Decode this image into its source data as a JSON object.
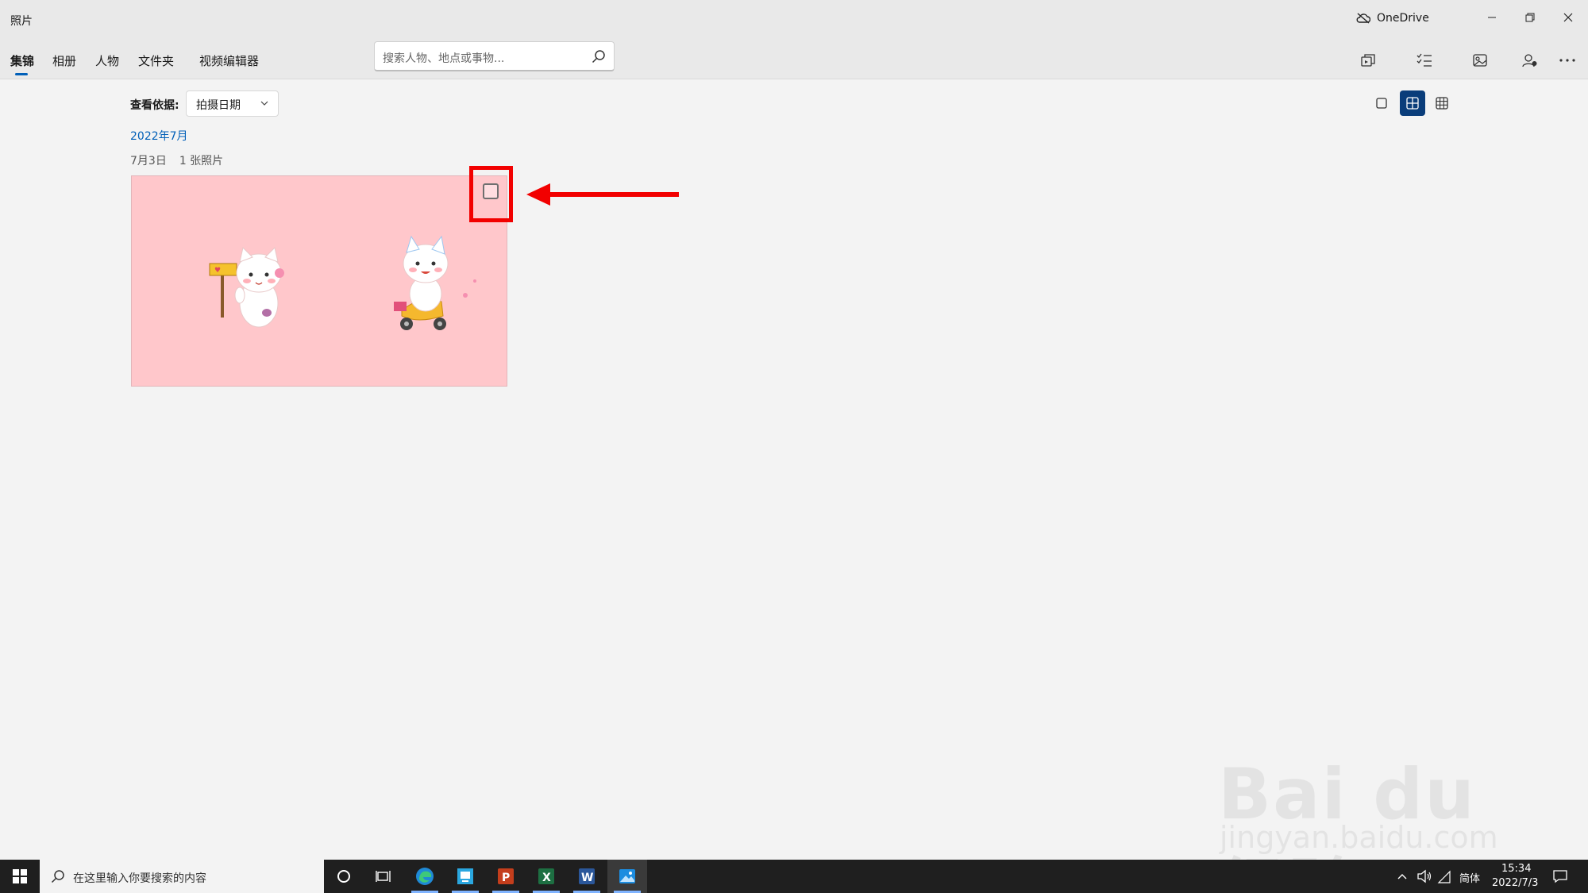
{
  "window": {
    "title": "照片",
    "onedrive_label": "OneDrive"
  },
  "nav": {
    "tabs": [
      "集锦",
      "相册",
      "人物",
      "文件夹",
      "视频编辑器"
    ],
    "active_tab": 0,
    "search_placeholder": "搜索人物、地点或事物..."
  },
  "toolbar_icons": [
    "slideshow-icon",
    "select-icon",
    "import-icon",
    "account-icon",
    "more-icon"
  ],
  "content": {
    "view_by_label": "查看依据:",
    "view_by_value": "拍摄日期",
    "month": "2022年7月",
    "day": "7月3日",
    "count": "1 张照片",
    "photo_sign_text": "♥",
    "size_options": [
      "single-view",
      "medium-grid",
      "small-grid"
    ],
    "active_size": 1
  },
  "watermark": {
    "logo": "Bai du 经验",
    "url": "jingyan.baidu.com"
  },
  "taskbar": {
    "search_placeholder": "在这里输入你要搜索的内容",
    "ime": "简体",
    "time": "15:34",
    "date": "2022/7/3"
  },
  "colors": {
    "accent": "#005fb8",
    "highlight": "#f20000",
    "photo_bg": "#ffc7cb"
  }
}
